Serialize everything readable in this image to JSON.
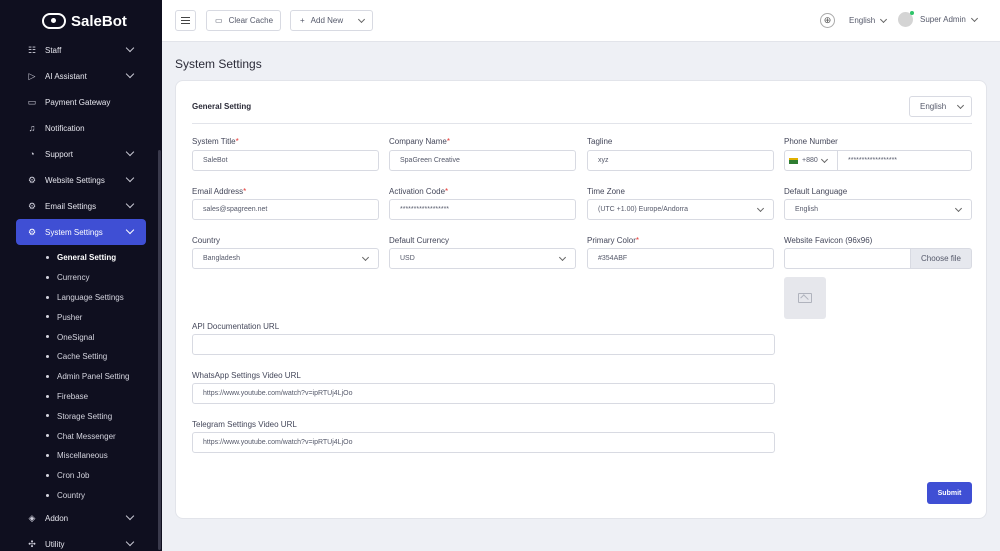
{
  "brand": {
    "name": "SaleBot"
  },
  "sidebar": {
    "items": [
      {
        "label": "Staff",
        "icon": "staff-icon"
      },
      {
        "label": "AI Assistant",
        "icon": "ai-icon"
      },
      {
        "label": "Payment Gateway",
        "icon": "card-icon"
      },
      {
        "label": "Notification",
        "icon": "bell-icon"
      },
      {
        "label": "Support",
        "icon": "support-icon"
      },
      {
        "label": "Website Settings",
        "icon": "gear-icon"
      },
      {
        "label": "Email Settings",
        "icon": "gear-icon"
      },
      {
        "label": "System Settings",
        "icon": "gear-icon"
      }
    ],
    "subitems": [
      "General Setting",
      "Currency",
      "Language Settings",
      "Pusher",
      "OneSignal",
      "Cache Setting",
      "Admin Panel Setting",
      "Firebase",
      "Storage Setting",
      "Chat Messenger",
      "Miscellaneous",
      "Cron Job",
      "Country"
    ],
    "bottom_items": [
      {
        "label": "Addon",
        "icon": "addon-icon"
      },
      {
        "label": "Utility",
        "icon": "utility-icon"
      }
    ]
  },
  "header": {
    "clear_cache": "Clear Cache",
    "add_new": "Add New",
    "language": "English",
    "user": "Super Admin"
  },
  "page": {
    "title": "System Settings"
  },
  "card": {
    "title": "General Setting",
    "language_select": "English"
  },
  "form": {
    "system_title": {
      "label": "System Title",
      "value": "SaleBot"
    },
    "company_name": {
      "label": "Company Name",
      "value": "SpaGreen Creative"
    },
    "tagline": {
      "label": "Tagline",
      "value": "xyz"
    },
    "phone_number": {
      "label": "Phone Number",
      "code": "+880",
      "value": "******************"
    },
    "email_address": {
      "label": "Email Address",
      "value": "sales@spagreen.net"
    },
    "activation_code": {
      "label": "Activation Code",
      "value": "******************"
    },
    "time_zone": {
      "label": "Time Zone",
      "value": "(UTC +1.00) Europe/Andorra"
    },
    "default_language": {
      "label": "Default Language",
      "value": "English"
    },
    "country": {
      "label": "Country",
      "value": "Bangladesh"
    },
    "default_currency": {
      "label": "Default Currency",
      "value": "USD"
    },
    "primary_color": {
      "label": "Primary Color",
      "value": "#354ABF"
    },
    "website_favicon": {
      "label": "Website Favicon (96x96)",
      "button": "Choose file"
    },
    "api_doc_url": {
      "label": "API Documentation URL",
      "value": ""
    },
    "whatsapp_video_url": {
      "label": "WhatsApp Settings Video URL",
      "value": "https://www.youtube.com/watch?v=ipRTUj4LjOo"
    },
    "telegram_video_url": {
      "label": "Telegram Settings Video URL",
      "value": "https://www.youtube.com/watch?v=ipRTUj4LjOo"
    },
    "submit": "Submit"
  },
  "colors": {
    "sidebar_bg": "#0f0f1f",
    "accent": "#3f4fd4",
    "required": "#e53935"
  }
}
